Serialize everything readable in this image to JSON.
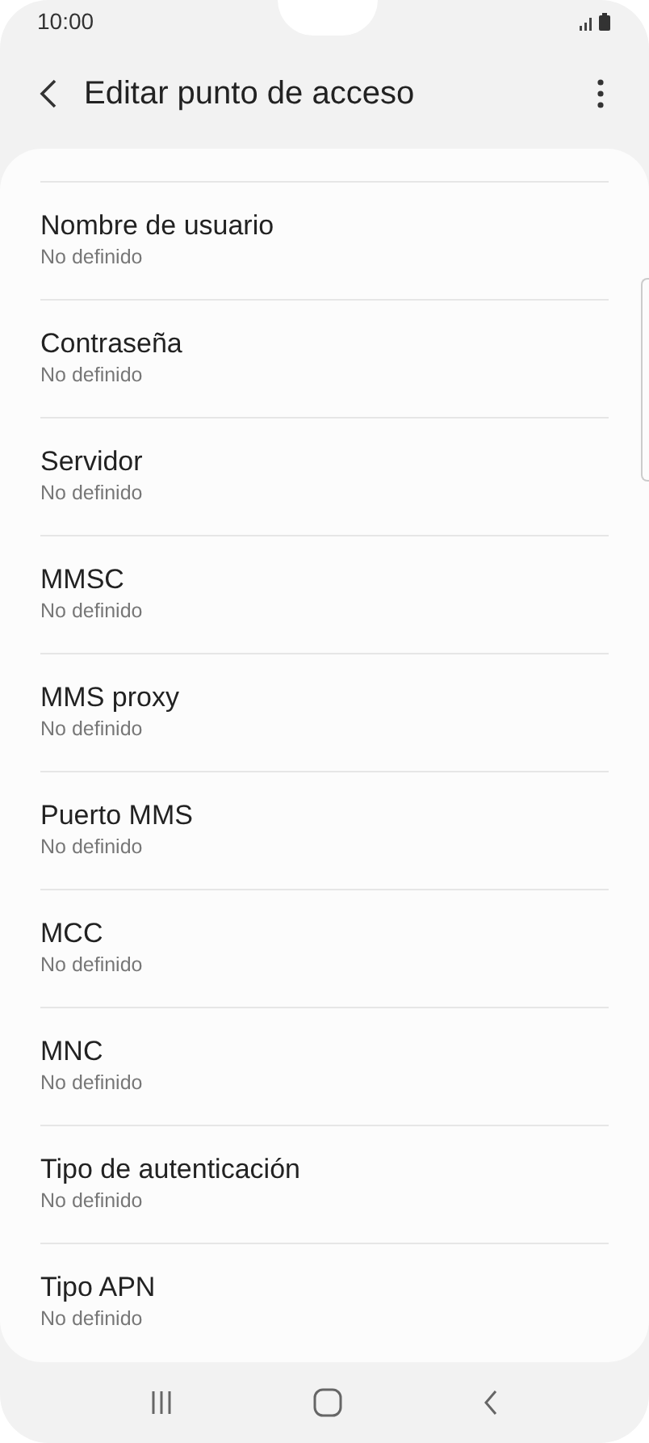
{
  "status_bar": {
    "time": "10:00"
  },
  "header": {
    "title": "Editar punto de acceso"
  },
  "settings": [
    {
      "label": "Nombre de usuario",
      "value": "No definido"
    },
    {
      "label": "Contraseña",
      "value": "No definido"
    },
    {
      "label": "Servidor",
      "value": "No definido"
    },
    {
      "label": "MMSC",
      "value": "No definido"
    },
    {
      "label": "MMS proxy",
      "value": "No definido"
    },
    {
      "label": "Puerto MMS",
      "value": "No definido"
    },
    {
      "label": "MCC",
      "value": "No definido"
    },
    {
      "label": "MNC",
      "value": "No definido"
    },
    {
      "label": "Tipo de autenticación",
      "value": "No definido"
    },
    {
      "label": "Tipo APN",
      "value": "No definido"
    }
  ]
}
